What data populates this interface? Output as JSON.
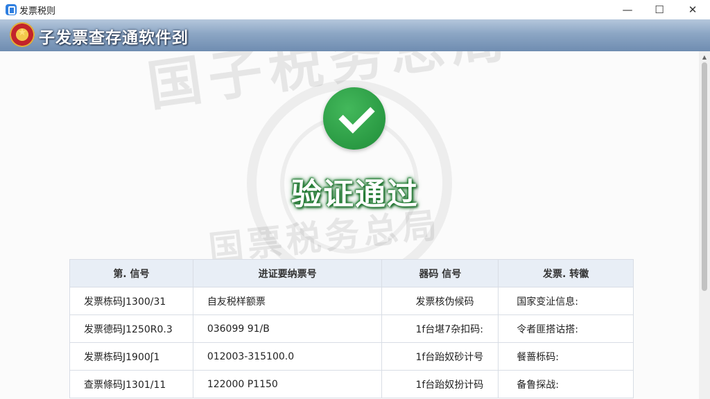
{
  "window": {
    "title": "发票税则",
    "minimize_glyph": "—",
    "maximize_glyph": "☐",
    "close_glyph": "✕"
  },
  "header": {
    "title": "子发票查存通软件刭"
  },
  "watermark": {
    "top": "国子税务总局",
    "middle": "国票税务总局"
  },
  "result": {
    "status": "验证通过",
    "status_color": "#2a9a43"
  },
  "table": {
    "headers": [
      "第. 信号",
      "进证要纳票号",
      "器码 信号",
      "发票. 转徽"
    ],
    "rows": [
      [
        "发票栋码J1300/31",
        "自友税样额票",
        "发票核伪候码",
        "国家变沚信息:"
      ],
      [
        "发票德码J1250R0.3",
        "036099  91/B",
        "1f台堪7杂扣码:",
        "令者匪搭诂搭:"
      ],
      [
        "发票栋码J1900ʃ1",
        "012003-315100.0",
        "1f台跆奴砂计号",
        "餐蔷栎码:"
      ],
      [
        "查票條码J1301/11",
        "122000 P1150",
        "1f台跆奴扮计码",
        "备鲁探战:"
      ]
    ]
  },
  "colors": {
    "banner_top": "#b5c7dc",
    "banner_bottom": "#6f8db1",
    "table_header_bg": "#e8eef6"
  }
}
